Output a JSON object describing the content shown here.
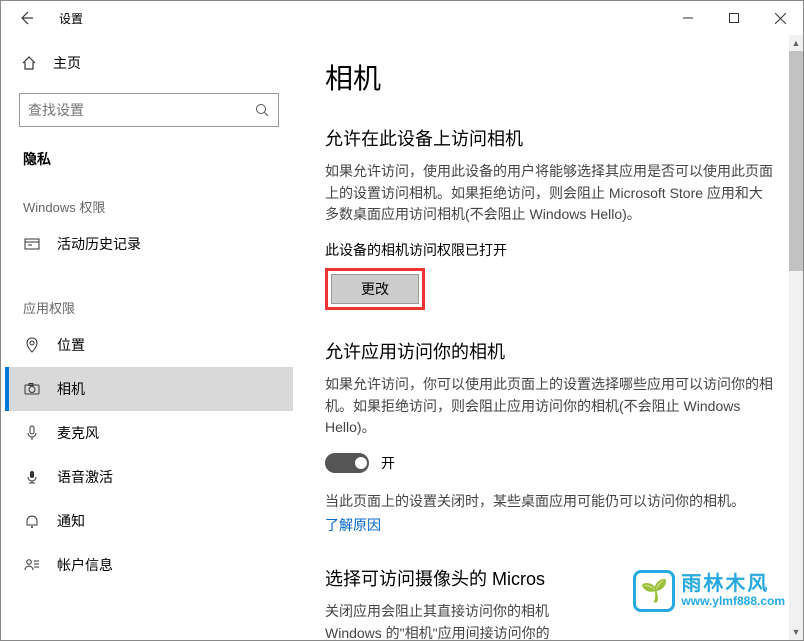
{
  "titlebar": {
    "title": "设置"
  },
  "sidebar": {
    "home": "主页",
    "search_placeholder": "查找设置",
    "category": "隐私",
    "group_windows": "Windows 权限",
    "group_app": "应用权限",
    "items": {
      "activity": "活动历史记录",
      "location": "位置",
      "camera": "相机",
      "microphone": "麦克风",
      "voice": "语音激活",
      "notifications": "通知",
      "account": "帐户信息"
    }
  },
  "main": {
    "page_title": "相机",
    "sec1_title": "允许在此设备上访问相机",
    "sec1_body": "如果允许访问，使用此设备的用户将能够选择其应用是否可以使用此页面上的设置访问相机。如果拒绝访问，则会阻止 Microsoft Store 应用和大多数桌面应用访问相机(不会阻止 Windows Hello)。",
    "status_line": "此设备的相机访问权限已打开",
    "change_btn": "更改",
    "sec2_title": "允许应用访问你的相机",
    "sec2_body": "如果允许访问，你可以使用此页面上的设置选择哪些应用可以访问你的相机。如果拒绝访问，则会阻止应用访问你的相机(不会阻止 Windows Hello)。",
    "toggle_label": "开",
    "note1": "当此页面上的设置关闭时，某些桌面应用可能仍可以访问你的相机。",
    "learn_more": "了解原因",
    "sec3_title": "选择可访问摄像头的 Micros",
    "sec3_body": "关闭应用会阻止其直接访问你的相机",
    "sec3_body2": "Windows 的\"相机\"应用间接访问你的"
  },
  "watermark": {
    "cn": "雨林木风",
    "url": "www.ylmf888.com"
  }
}
